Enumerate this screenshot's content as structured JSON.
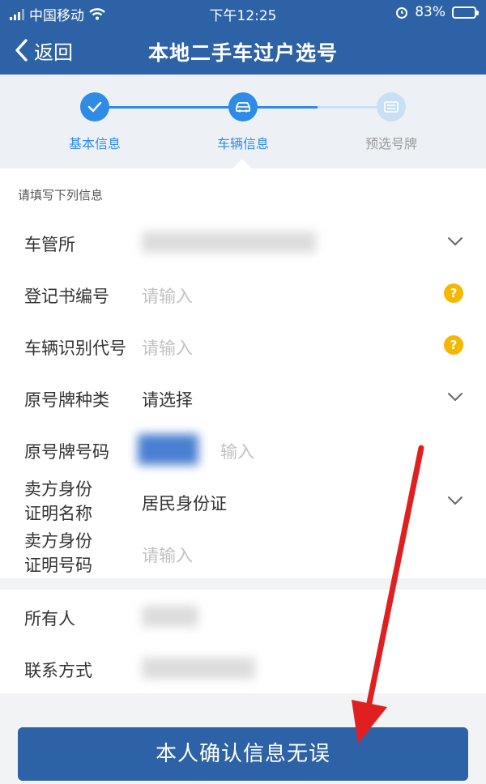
{
  "status_bar": {
    "carrier": "中国移动",
    "time": "下午12:25",
    "battery": "83%",
    "battery_level": 0.83
  },
  "nav": {
    "back_label": "返回",
    "title": "本地二手车过户选号"
  },
  "steps": [
    {
      "label": "基本信息",
      "icon": "check-icon",
      "state": "done"
    },
    {
      "label": "车辆信息",
      "icon": "car-icon",
      "state": "current"
    },
    {
      "label": "预选号牌",
      "icon": "plate-icon",
      "state": "pending"
    }
  ],
  "form": {
    "hint": "请填写下列信息",
    "fields": [
      {
        "label": "车管所",
        "value": ""
      },
      {
        "label": "登记书编号",
        "placeholder": "请输入"
      },
      {
        "label": "车辆识别代号",
        "placeholder": "请输入"
      },
      {
        "label": "原号牌种类",
        "value": "请选择"
      },
      {
        "label": "原号牌号码",
        "placeholder": "输入"
      },
      {
        "label": "卖方身份证明名称",
        "value": "居民身份证"
      },
      {
        "label": "卖方身份证明号码",
        "placeholder": "请输入"
      }
    ],
    "owner_fields": [
      {
        "label": "所有人",
        "value": ""
      },
      {
        "label": "联系方式",
        "value": ""
      }
    ]
  },
  "confirm_button": "本人确认信息无误",
  "colors": {
    "primary": "#2d63a6",
    "step_active": "#2f8ce6",
    "step_pending": "#c9dff3",
    "help": "#f5b800",
    "annotation_arrow": "#e02020"
  }
}
